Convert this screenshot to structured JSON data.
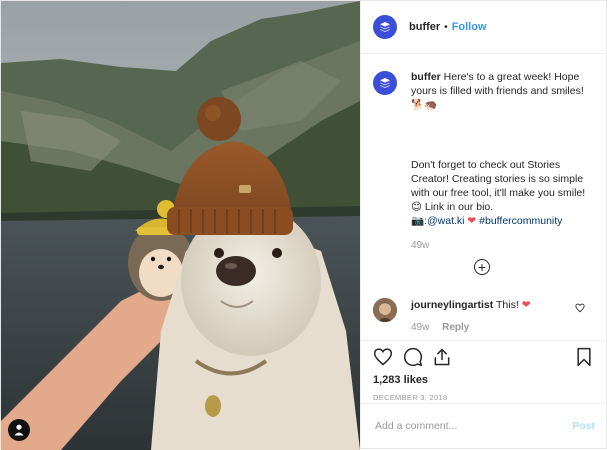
{
  "post": {
    "username": "buffer",
    "header_dot": "•",
    "follow_label": "Follow",
    "avatar_icon": "buffer-logo-icon",
    "brand_color": "#3a4ed8",
    "link_color": "#3897f0"
  },
  "caption": {
    "username": "buffer",
    "line1": "Here's to a great week! Hope yours is filled with friends and smiles!",
    "emoji1": "🐕🦔",
    "line2": "Don't forget to check out Stories Creator! Creating stories is so simple with our free tool, it'll make you smile! 😊 Link in our bio.",
    "camera_emoji": "📷",
    "credit": ":@wat.ki",
    "heart": "❤",
    "hashtag": "#buffercommunity",
    "time": "49w"
  },
  "load_more_icon": "plus-circle-icon",
  "comment": {
    "username": "journeylingartist",
    "text": "This!",
    "heart": "❤",
    "time": "49w",
    "reply_label": "Reply"
  },
  "actions": {
    "icons": [
      "heart-icon",
      "comment-icon",
      "share-icon",
      "bookmark-icon"
    ],
    "likes": "1,283 likes",
    "date": "DECEMBER 3, 2018"
  },
  "add_comment": {
    "placeholder": "Add a comment...",
    "post_label": "Post"
  }
}
